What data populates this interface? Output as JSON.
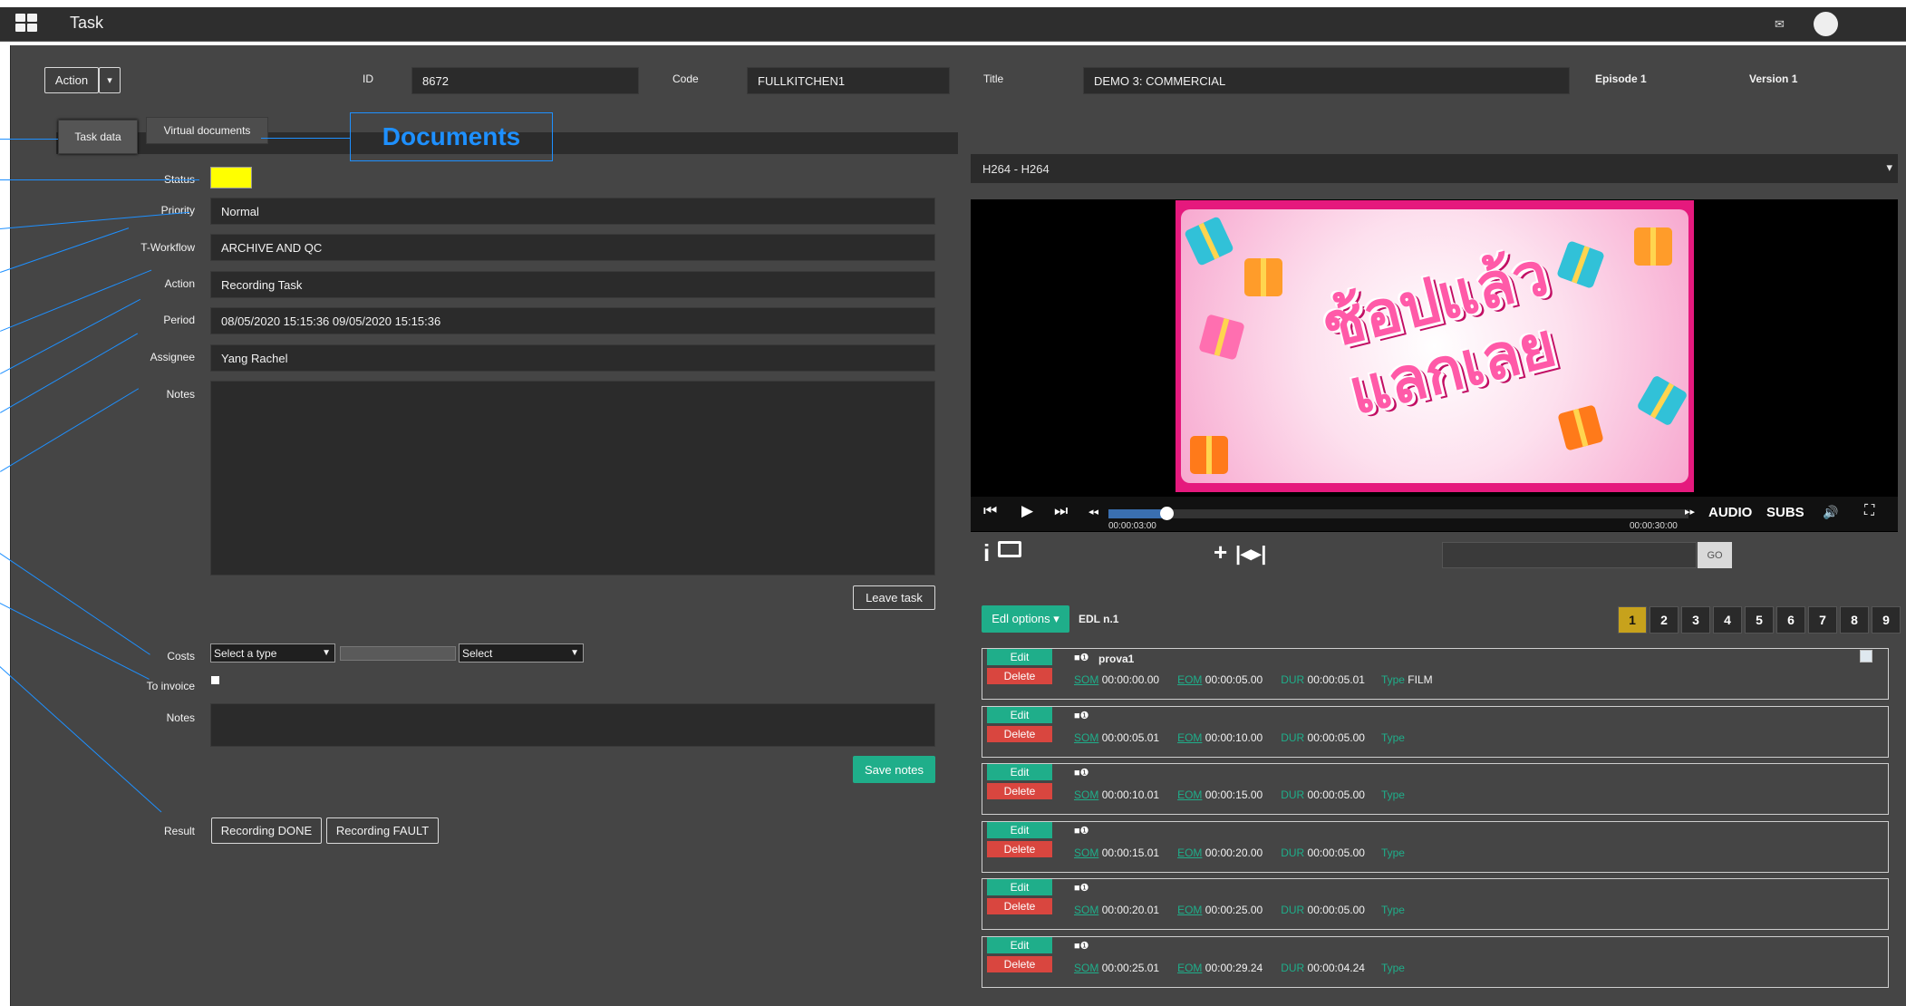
{
  "header": {
    "title": "Task"
  },
  "toolbar": {
    "action_label": "Action",
    "caret": "▾"
  },
  "meta": {
    "id_label": "ID",
    "id_value": "8672",
    "code_label": "Code",
    "code_value": "FULLKITCHEN1",
    "title_label": "Title",
    "title_value": "DEMO 3: COMMERCIAL",
    "episode": "Episode 1",
    "version": "Version 1"
  },
  "tabs": {
    "task_data": "Task data",
    "virtual_documents": "Virtual documents"
  },
  "callout": "Documents",
  "form": {
    "status_label": "Status",
    "status_color": "#ffff00",
    "priority_label": "Priority",
    "priority_value": "Normal",
    "workflow_label": "T-Workflow",
    "workflow_value": "ARCHIVE AND QC",
    "action_label": "Action",
    "action_value": "Recording Task",
    "period_label": "Period",
    "period_value": "08/05/2020 15:15:36 09/05/2020 15:15:36",
    "assignee_label": "Assignee",
    "assignee_value": "Yang Rachel",
    "notes_label": "Notes",
    "leave_task": "Leave task",
    "costs_label": "Costs",
    "costs_type_placeholder": "Select a type",
    "costs_select": "Select",
    "invoice_label": "To invoice",
    "notes2_label": "Notes",
    "save_notes": "Save notes",
    "result_label": "Result",
    "result_done": "Recording DONE",
    "result_fault": "Recording FAULT"
  },
  "player": {
    "format": "H264 - H264",
    "dropdown_arrow": "▾",
    "overlay_text": "ช้อปแล้ว แลกเลย",
    "time_current": "00:00:03:00",
    "time_total": "00:00:30:00",
    "progress": 0.1,
    "audio": "AUDIO",
    "subs": "SUBS",
    "go": "GO"
  },
  "edl": {
    "options_label": "Edl options ▾",
    "name": "EDL n.1",
    "pages": [
      "1",
      "2",
      "3",
      "4",
      "5",
      "6",
      "7",
      "8",
      "9"
    ],
    "active_page": "1",
    "edit": "Edit",
    "delete": "Delete",
    "som": "SOM",
    "eom": "EOM",
    "dur": "DUR",
    "type": "Type",
    "rows": [
      {
        "name": "prova1",
        "som": "00:00:00.00",
        "eom": "00:00:05.00",
        "dur": "00:00:05.01",
        "type": "FILM"
      },
      {
        "name": "",
        "som": "00:00:05.01",
        "eom": "00:00:10.00",
        "dur": "00:00:05.00",
        "type": ""
      },
      {
        "name": "",
        "som": "00:00:10.01",
        "eom": "00:00:15.00",
        "dur": "00:00:05.00",
        "type": ""
      },
      {
        "name": "",
        "som": "00:00:15.01",
        "eom": "00:00:20.00",
        "dur": "00:00:05.00",
        "type": ""
      },
      {
        "name": "",
        "som": "00:00:20.01",
        "eom": "00:00:25.00",
        "dur": "00:00:05.00",
        "type": ""
      },
      {
        "name": "",
        "som": "00:00:25.01",
        "eom": "00:00:29.24",
        "dur": "00:00:04.24",
        "type": ""
      }
    ]
  },
  "colors": {
    "accent": "#1fae8a",
    "danger": "#d9463f",
    "callout": "#1e90ff",
    "status": "#ffff00"
  }
}
